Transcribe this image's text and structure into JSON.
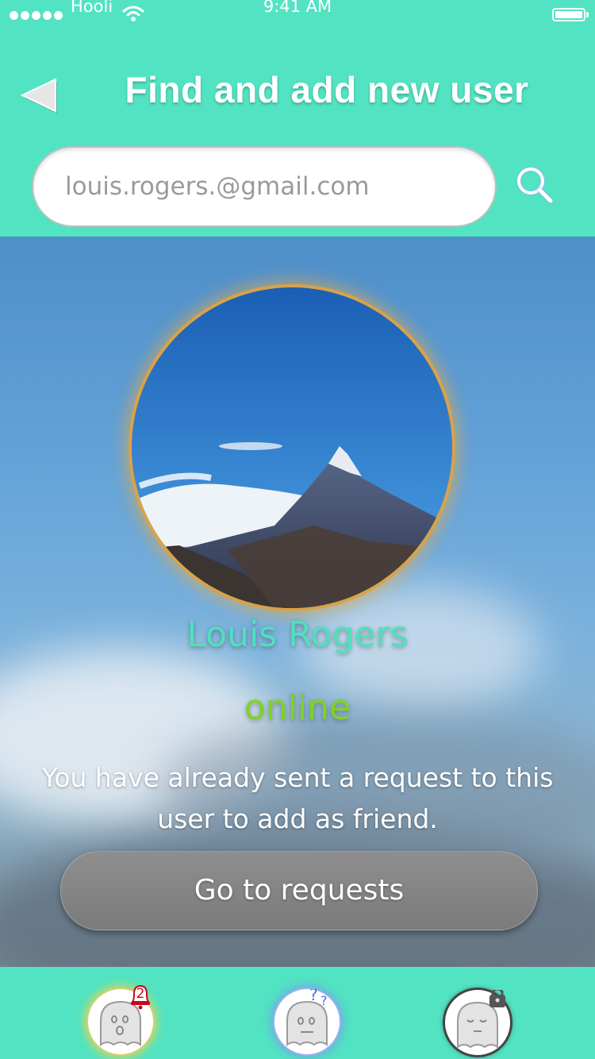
{
  "status_bar": {
    "carrier": "Hooli",
    "time": "9:41 AM"
  },
  "header": {
    "title": "Find and add new user",
    "back_icon": "back-triangle-icon"
  },
  "search": {
    "value": "",
    "placeholder": "louis.rogers.@gmail.com",
    "icon": "search-icon"
  },
  "profile": {
    "name": "Louis Rogers",
    "status": "online",
    "message": "You have already sent a request to this user to add as friend.",
    "action_label": "Go to requests"
  },
  "tabs": [
    {
      "name": "notifications",
      "icon": "ghost-bell-icon",
      "badge": "2"
    },
    {
      "name": "help",
      "icon": "ghost-question-icon"
    },
    {
      "name": "profile",
      "icon": "ghost-lock-icon"
    }
  ],
  "colors": {
    "accent": "#52e3c2",
    "name": "#4fe0bd",
    "online": "#7ed321",
    "ring": "#d9a24a"
  }
}
